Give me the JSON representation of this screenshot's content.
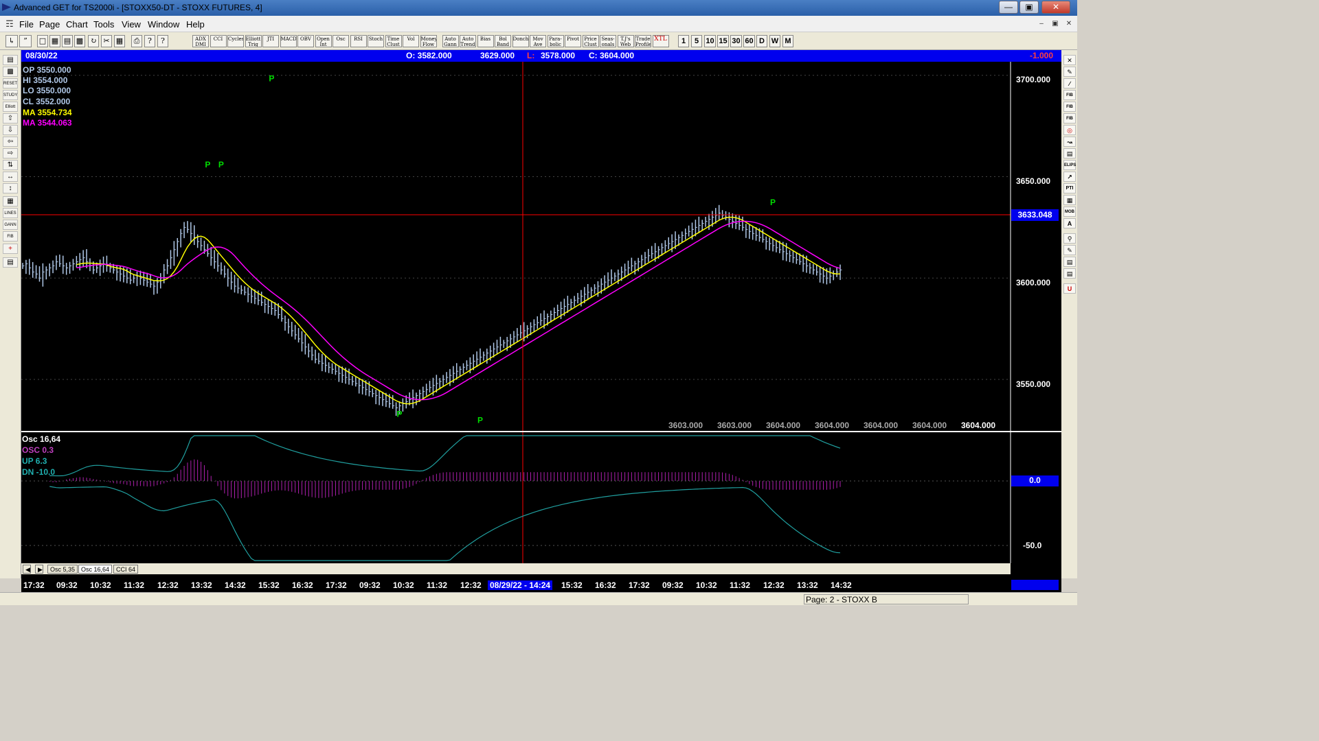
{
  "window": {
    "title": "Advanced GET for TS2000i - [STOXX50-DT - STOXX FUTURES, 4]"
  },
  "menu": {
    "items": [
      "File",
      "Page",
      "Chart",
      "Tools",
      "View",
      "Window",
      "Help"
    ]
  },
  "toolbar": {
    "study_buttons": [
      "ADX DMI",
      "CCI",
      "Cycles",
      "Elliott Trig",
      "JTI",
      "MACD",
      "OBV",
      "Open Int",
      "Osc",
      "RSI",
      "Stoch",
      "Time Clust",
      "Vol",
      "Money Flow",
      "Auto Gann",
      "Auto Trend",
      "Bias",
      "Bol Band",
      "Donch",
      "Mov Ave",
      "Para-bolic",
      "Pivot",
      "Price Clust",
      "Seas-onals",
      "T.J's Web",
      "Trade Profile",
      "XTL"
    ],
    "interval_buttons": [
      "1",
      "5",
      "10",
      "15",
      "30",
      "60",
      "D",
      "W",
      "M"
    ]
  },
  "left_tools": [
    "STUDY",
    "Elliott",
    "RESET",
    "LINES",
    "GANN",
    "FIB"
  ],
  "right_tools": [
    "FIB RET",
    "FIB EXT",
    "FIB TIME",
    "ELIPS",
    "PTI",
    "MOB",
    "A",
    "U"
  ],
  "info_bar": {
    "date": "08/30/22",
    "open": "O: 3582.000",
    "high": "3629.000",
    "low_label": "L:",
    "low": "3578.000",
    "close": "C: 3604.000",
    "change": "-1.000"
  },
  "legend": {
    "op": "OP  3550.000",
    "hi": "HI   3554.000",
    "lo": "LO  3550.000",
    "cl": "CL  3552.000",
    "ma1": "MA  3554.734",
    "ma2": "MA  3544.063"
  },
  "price_axis": {
    "labels": [
      "3700.000",
      "3650.000",
      "3600.000",
      "3550.000"
    ],
    "crosshair_value": "3633.048"
  },
  "bottom_values": [
    "3603.000",
    "3603.000",
    "3604.000",
    "3604.000",
    "3604.000",
    "3604.000",
    "3604.000"
  ],
  "osc_panel": {
    "title": "Osc 16,64",
    "osc": "OSC  0.3",
    "up": "UP   6.3",
    "dn": "DN  -10.0",
    "axis_zero": "0.0",
    "axis_minus50": "-50.0"
  },
  "tabs": [
    "Osc 5,35",
    "Osc 16,64",
    "CCI 64"
  ],
  "time_axis": {
    "labels": [
      "17:32",
      "09:32",
      "10:32",
      "11:32",
      "12:32",
      "13:32",
      "14:32",
      "15:32",
      "16:32",
      "17:32",
      "09:32",
      "10:32",
      "11:32",
      "12:32",
      "08/29/22 - 14:24",
      "15:32",
      "16:32",
      "17:32",
      "09:32",
      "10:32",
      "11:32",
      "12:32",
      "13:32",
      "14:32"
    ]
  },
  "status": {
    "page": "Page: 2 - STOXX B"
  },
  "colors": {
    "ma_yellow": "#ffff00",
    "ma_magenta": "#ff00ff",
    "candle": "#b0c8e8",
    "info_blue": "#0000ee",
    "pivot_green": "#00dd00"
  },
  "chart_data": {
    "type": "ohlc",
    "pivot_label": "P",
    "ylim": [
      3528,
      3705
    ],
    "pivots": [
      {
        "x": 74,
        "price": 3695,
        "pos": "top"
      },
      {
        "x": 55,
        "price": 3660,
        "pos": "bottom"
      },
      {
        "x": 59,
        "price": 3660,
        "pos": "bottom"
      },
      {
        "x": 112,
        "price": 3537,
        "pos": "bottom"
      },
      {
        "x": 136,
        "price": 3534,
        "pos": "bottom"
      },
      {
        "x": 223,
        "price": 3634,
        "pos": "top"
      }
    ],
    "close": [
      3606,
      3607,
      3605,
      3603,
      3602,
      3600,
      3603,
      3604,
      3605,
      3606,
      3608,
      3607,
      3606,
      3605,
      3606,
      3607,
      3608,
      3609,
      3610,
      3608,
      3606,
      3604,
      3605,
      3606,
      3607,
      3606,
      3605,
      3604,
      3603,
      3602,
      3601,
      3600,
      3599,
      3600,
      3601,
      3600,
      3599,
      3598,
      3597,
      3596,
      3598,
      3600,
      3604,
      3606,
      3610,
      3614,
      3618,
      3622,
      3625,
      3624,
      3622,
      3620,
      3618,
      3616,
      3614,
      3612,
      3610,
      3608,
      3606,
      3604,
      3602,
      3600,
      3598,
      3596,
      3595,
      3594,
      3593,
      3592,
      3591,
      3590,
      3589,
      3588,
      3587,
      3586,
      3585,
      3584,
      3582,
      3580,
      3578,
      3576,
      3574,
      3572,
      3570,
      3568,
      3566,
      3564,
      3562,
      3560,
      3559,
      3558,
      3557,
      3556,
      3555,
      3554,
      3553,
      3552,
      3551,
      3550,
      3549,
      3548,
      3547,
      3546,
      3545,
      3544,
      3543,
      3542,
      3541,
      3540,
      3539,
      3538,
      3537,
      3536,
      3537,
      3538,
      3539,
      3540,
      3541,
      3542,
      3543,
      3544,
      3545,
      3546,
      3547,
      3548,
      3549,
      3550,
      3551,
      3552,
      3553,
      3554,
      3555,
      3556,
      3557,
      3558,
      3559,
      3560,
      3561,
      3562,
      3563,
      3564,
      3565,
      3566,
      3567,
      3568,
      3569,
      3570,
      3571,
      3572,
      3573,
      3574,
      3575,
      3576,
      3577,
      3578,
      3579,
      3580,
      3581,
      3582,
      3583,
      3584,
      3585,
      3586,
      3587,
      3588,
      3589,
      3590,
      3591,
      3592,
      3593,
      3594,
      3595,
      3596,
      3597,
      3598,
      3599,
      3600,
      3601,
      3602,
      3603,
      3604,
      3605,
      3606,
      3607,
      3608,
      3609,
      3610,
      3611,
      3612,
      3613,
      3614,
      3615,
      3616,
      3617,
      3618,
      3619,
      3620,
      3621,
      3622,
      3623,
      3624,
      3625,
      3626,
      3627,
      3628,
      3629,
      3630,
      3631,
      3632,
      3631,
      3630,
      3629,
      3628,
      3627,
      3626,
      3625,
      3624,
      3623,
      3622,
      3621,
      3620,
      3619,
      3618,
      3617,
      3616,
      3615,
      3614,
      3613,
      3612,
      3611,
      3610,
      3609,
      3608,
      3607,
      3606,
      3605,
      3604,
      3603,
      3602,
      3601,
      3600,
      3601,
      3602,
      3603,
      3604
    ]
  }
}
